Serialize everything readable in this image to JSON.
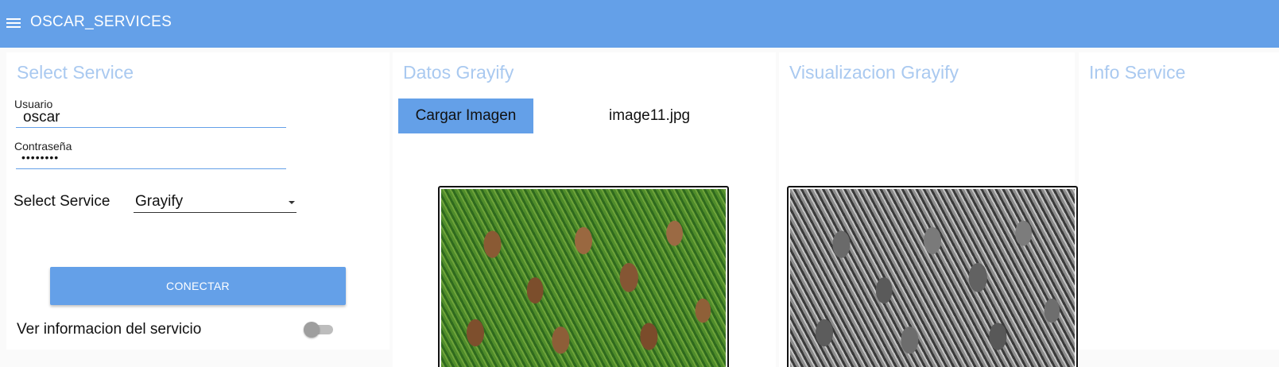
{
  "app": {
    "title": "OSCAR_SERVICES"
  },
  "select_service_panel": {
    "title": "Select Service",
    "usuario": {
      "label": "Usuario",
      "value": "oscar"
    },
    "contrasena": {
      "label": "Contraseña",
      "value": "••••••••"
    },
    "service_select": {
      "label": "Select Service",
      "value": "Grayify"
    },
    "connect_button": "CONECTAR",
    "info_toggle": {
      "label": "Ver informacion del servicio",
      "checked": false
    }
  },
  "datos_panel": {
    "title": "Datos Grayify",
    "upload_button": "Cargar Imagen",
    "file_name": "image11.jpg"
  },
  "visualizacion_panel": {
    "title": "Visualizacion Grayify"
  },
  "info_panel": {
    "title": "Info Service"
  },
  "icons": {
    "menu": "menu-icon",
    "dropdown": "chevron-down-icon"
  },
  "colors": {
    "accent": "#64a0e8",
    "panel_title": "#a9c9f0"
  }
}
